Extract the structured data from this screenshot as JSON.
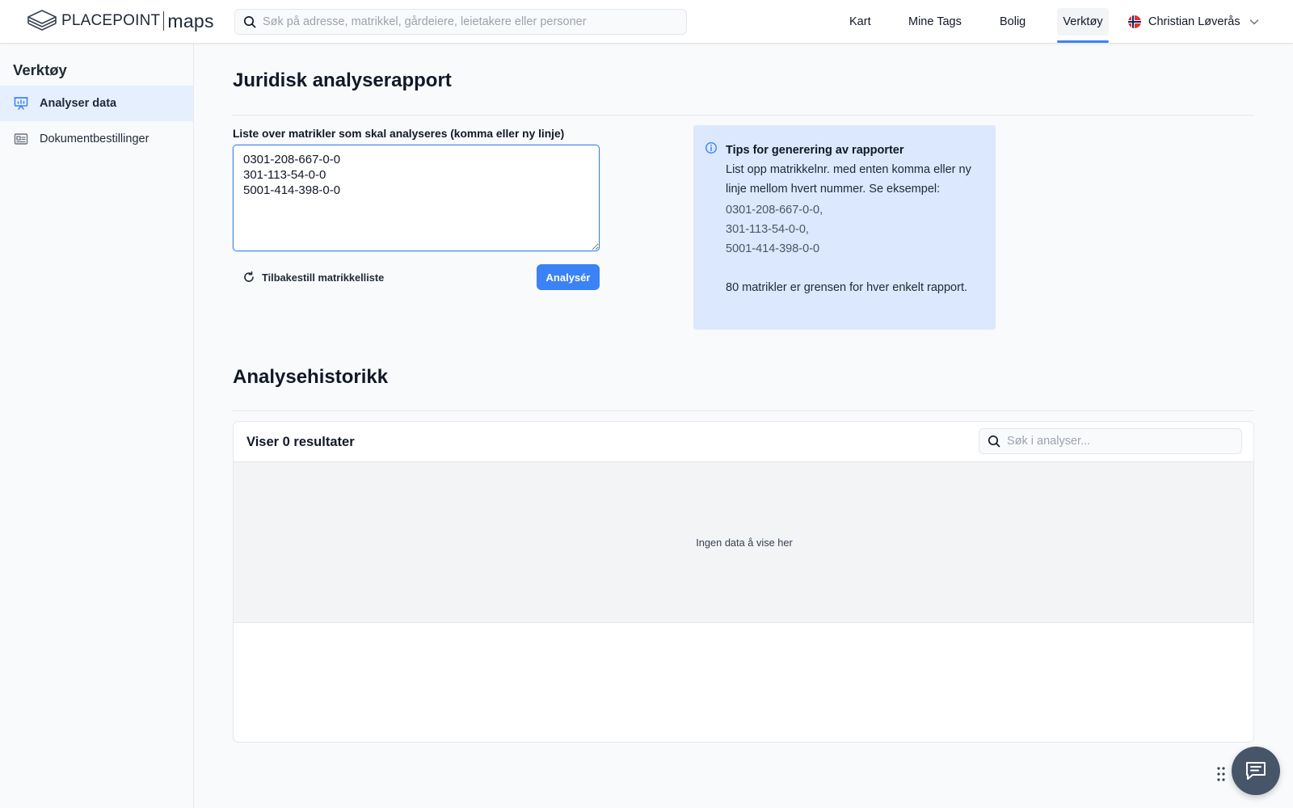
{
  "header": {
    "logo_brand": "PLACEPOINT",
    "logo_product": "maps",
    "search_placeholder": "Søk på adresse, matrikkel, gårdeiere, leietakere eller personer",
    "nav": [
      {
        "label": "Kart"
      },
      {
        "label": "Mine Tags"
      },
      {
        "label": "Bolig"
      },
      {
        "label": "Verktøy",
        "active": true
      }
    ],
    "user_name": "Christian Løverås",
    "user_flag": "norway-flag-icon"
  },
  "sidebar": {
    "title": "Verktøy",
    "items": [
      {
        "label": "Analyser data",
        "icon": "presentation-chart-icon",
        "active": true
      },
      {
        "label": "Dokumentbestillinger",
        "icon": "id-card-icon"
      }
    ]
  },
  "report": {
    "title": "Juridisk analyserapport",
    "field_label": "Liste over matrikler som skal analyseres (komma eller ny linje)",
    "textarea_value": "0301-208-667-0-0\n301-113-54-0-0\n5001-414-398-0-0",
    "reset_label": "Tilbakestill matrikkelliste",
    "analyse_label": "Analysér"
  },
  "tips": {
    "title": "Tips for generering av rapporter",
    "text": "List opp matrikkelnr. med enten komma eller ny linje mellom hvert nummer. Se eksempel:",
    "examples": [
      "0301-208-667-0-0,",
      "301-113-54-0-0,",
      "5001-414-398-0-0"
    ],
    "limit": "80 matrikler er grensen for hver enkelt rapport."
  },
  "history": {
    "title": "Analysehistorikk",
    "results_count": "Viser 0 resultater",
    "search_placeholder": "Søk i analyser...",
    "empty_text": "Ingen data å vise her"
  },
  "colors": {
    "accent": "#3b82f6",
    "tips_bg": "#dbe8fd",
    "sidebar_active_bg": "#e5effd",
    "chat_button": "#475569"
  }
}
